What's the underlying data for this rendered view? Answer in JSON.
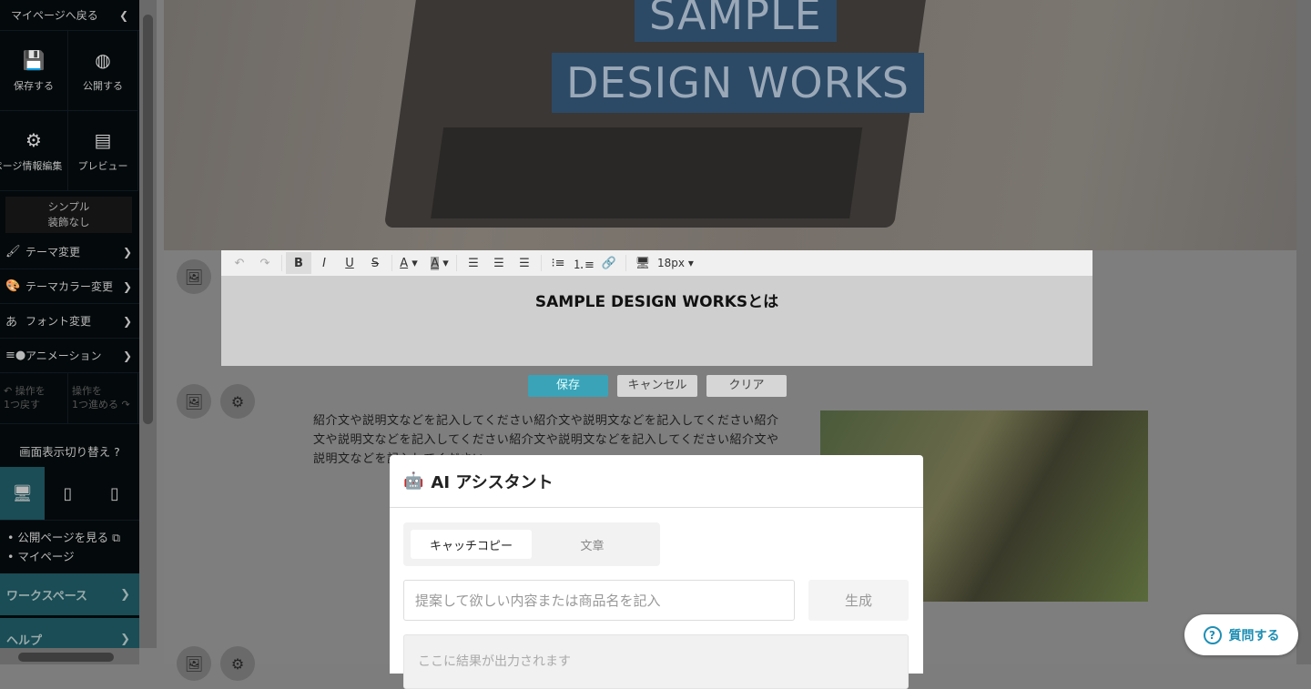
{
  "sidebar": {
    "back": "マイページへ戻る",
    "actions": [
      {
        "label": "保存する",
        "icon": "save-icon"
      },
      {
        "label": "公開する",
        "icon": "globe-icon"
      },
      {
        "label": "ページ情報編集",
        "icon": "gear-icon"
      },
      {
        "label": "プレビュー",
        "icon": "preview-icon"
      }
    ],
    "theme_line1": "シンプル",
    "theme_line2": "装飾なし",
    "menu": [
      {
        "label": "テーマ変更"
      },
      {
        "label": "テーマカラー変更"
      },
      {
        "label": "フォント変更"
      },
      {
        "label": "アニメーション"
      }
    ],
    "undo": "操作を\n1つ戻す",
    "redo": "操作を\n1つ進める",
    "display_switch": "画面表示切り替え",
    "links": [
      "公開ページを見る",
      "マイページ"
    ],
    "workspace": "ワークスペース",
    "help": "ヘルプ"
  },
  "hero": {
    "line1": "SAMPLE",
    "line2": "DESIGN WORKS"
  },
  "editor": {
    "font_size": "18px",
    "heading": "SAMPLE DESIGN WORKSとは",
    "save": "保存",
    "cancel": "キャンセル",
    "clear": "クリア"
  },
  "body_text": "紹介文や説明文などを記入してください紹介文や説明文などを記入してください紹介文や説明文などを記入してください紹介文や説明文などを記入してください紹介文や説明文などを記入してください",
  "modal": {
    "title": "AI アシスタント",
    "tabs": [
      "キャッチコピー",
      "文章"
    ],
    "prompt_placeholder": "提案して欲しい内容または商品名を記入",
    "generate": "生成",
    "result_placeholder": "ここに結果が出力されます"
  },
  "help_button": "質問する"
}
